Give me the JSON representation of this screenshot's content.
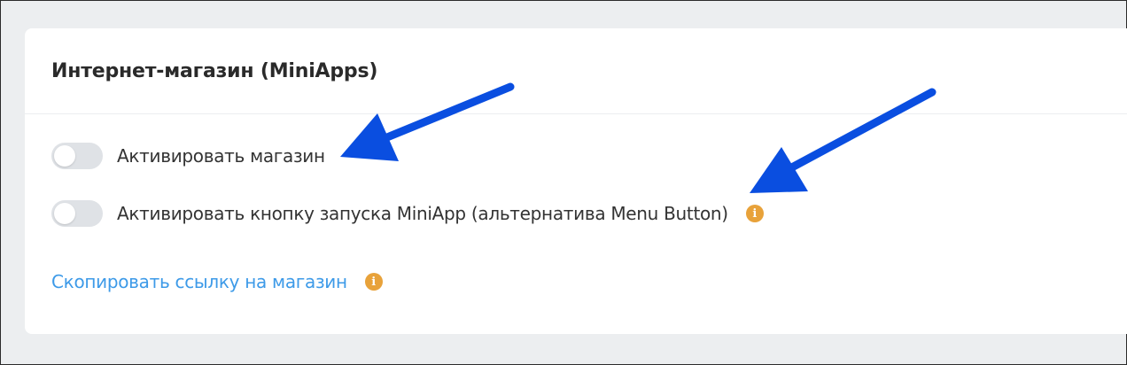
{
  "card": {
    "title": "Интернет-магазин (MiniApps)"
  },
  "settings": [
    {
      "label": "Активировать магазин",
      "enabled": false
    },
    {
      "label": "Активировать кнопку запуска MiniApp (альтернатива Menu Button)",
      "enabled": false,
      "info_icon": "info-icon"
    }
  ],
  "link": {
    "label": "Скопировать ссылку на магазин",
    "info_icon": "info-icon"
  },
  "icons": {
    "info_glyph": "i"
  },
  "colors": {
    "background": "#eceef0",
    "card": "#ffffff",
    "toggle_off": "#dfe2e6",
    "link": "#3d9ae8",
    "info": "#e8a23a",
    "annotation_arrow": "#0a4ee0"
  }
}
